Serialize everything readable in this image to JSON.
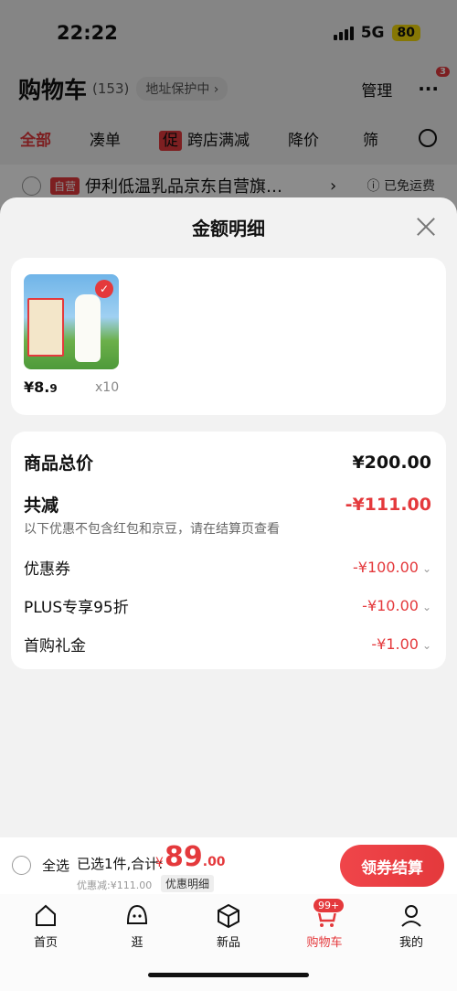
{
  "status_bar": {
    "time": "22:22",
    "network": "5G",
    "battery": "80"
  },
  "cart_header": {
    "title": "购物车",
    "count": "(153)",
    "address_chip": "地址保护中 ›",
    "manage": "管理",
    "more": "···",
    "more_badge": "3"
  },
  "filter_tabs": [
    {
      "label": "全部",
      "active": true
    },
    {
      "label": "凑单"
    },
    {
      "label": "跨店满减",
      "tag": "促"
    },
    {
      "label": "降价"
    },
    {
      "label": "筛"
    }
  ],
  "store_row": {
    "tag": "自营",
    "name": "伊利低温乳品京东自营旗…",
    "arrow": "›",
    "shipping": "已免运费"
  },
  "sheet": {
    "title": "金额明细",
    "product": {
      "price_main": "¥8.",
      "price_decimal": "9",
      "quantity": "x10"
    },
    "summary": {
      "total_label": "商品总价",
      "total_value": "¥200.00",
      "reduce_label": "共减",
      "reduce_value": "-¥111.00",
      "note": "以下优惠不包含红包和京豆，请在结算页查看",
      "items": [
        {
          "label": "优惠券",
          "value": "-¥100.00"
        },
        {
          "label": "PLUS专享95折",
          "value": "-¥10.00"
        },
        {
          "label": "首购礼金",
          "value": "-¥1.00"
        }
      ]
    }
  },
  "checkout": {
    "select_all": "全选",
    "selected_text": "已选1件,合计:",
    "yen": "¥",
    "total_int": "89",
    "total_dec": ".00",
    "discount_text": "优惠减:¥111.00",
    "detail_label": "优惠明细",
    "button_label": "领券结算"
  },
  "tabbar": [
    {
      "label": "首页"
    },
    {
      "label": "逛"
    },
    {
      "label": "新品"
    },
    {
      "label": "购物车",
      "badge": "99+",
      "active": true
    },
    {
      "label": "我的"
    }
  ]
}
